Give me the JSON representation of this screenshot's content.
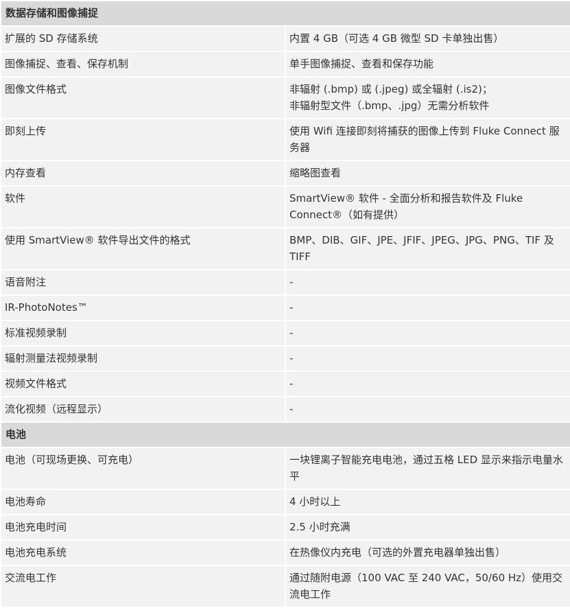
{
  "sections": [
    {
      "title": "数据存储和图像捕捉",
      "rows": [
        {
          "label": "扩展的 SD 存储系统",
          "value": [
            "内置 4 GB（可选 4 GB 微型 SD 卡单独出售）"
          ]
        },
        {
          "label": "图像捕捉、查看、保存机制",
          "value": [
            "单手图像捕捉、查看和保存功能"
          ]
        },
        {
          "label": "图像文件格式",
          "value": [
            "非辐射 (.bmp) 或 (.jpeg) 或全辐射 (.is2)；",
            "非辐射型文件（.bmp、.jpg）无需分析软件"
          ]
        },
        {
          "label": "即刻上传",
          "value": [
            "使用 Wifi 连接即刻将捕获的图像上传到 Fluke Connect 服务器"
          ]
        },
        {
          "label": "内存查看",
          "value": [
            "缩略图查看"
          ]
        },
        {
          "label": "软件",
          "value": [
            "SmartView® 软件 - 全面分析和报告软件及 Fluke Connect®（如有提供）"
          ]
        },
        {
          "label": "使用 SmartView® 软件导出文件的格式",
          "value": [
            "BMP、DIB、GIF、JPE、JFIF、JPEG、JPG、PNG、TIF 及 TIFF"
          ]
        },
        {
          "label": "语音附注",
          "value": [
            "-"
          ]
        },
        {
          "label": "IR-PhotoNotes™",
          "value": [
            "-"
          ]
        },
        {
          "label": "标准视频录制",
          "value": [
            "-"
          ]
        },
        {
          "label": "辐射测量法视频录制",
          "value": [
            "-"
          ]
        },
        {
          "label": "视频文件格式",
          "value": [
            "-"
          ]
        },
        {
          "label": "流化视频（远程显示）",
          "value": [
            "-"
          ]
        }
      ]
    },
    {
      "title": "电池",
      "rows": [
        {
          "label": "电池（可现场更换、可充电）",
          "value": [
            "一块锂离子智能充电电池，通过五格 LED 显示来指示电量水平"
          ]
        },
        {
          "label": "电池寿命",
          "value": [
            "4 小时以上"
          ]
        },
        {
          "label": "电池充电时间",
          "value": [
            "2.5 小时充满"
          ]
        },
        {
          "label": "电池充电系统",
          "value": [
            "在热像仪内充电（可选的外置充电器单独出售）"
          ]
        },
        {
          "label": "交流电工作",
          "value": [
            "通过随附电源（100 VAC 至 240 VAC，50/60 Hz）使用交流电工作"
          ]
        }
      ]
    }
  ]
}
